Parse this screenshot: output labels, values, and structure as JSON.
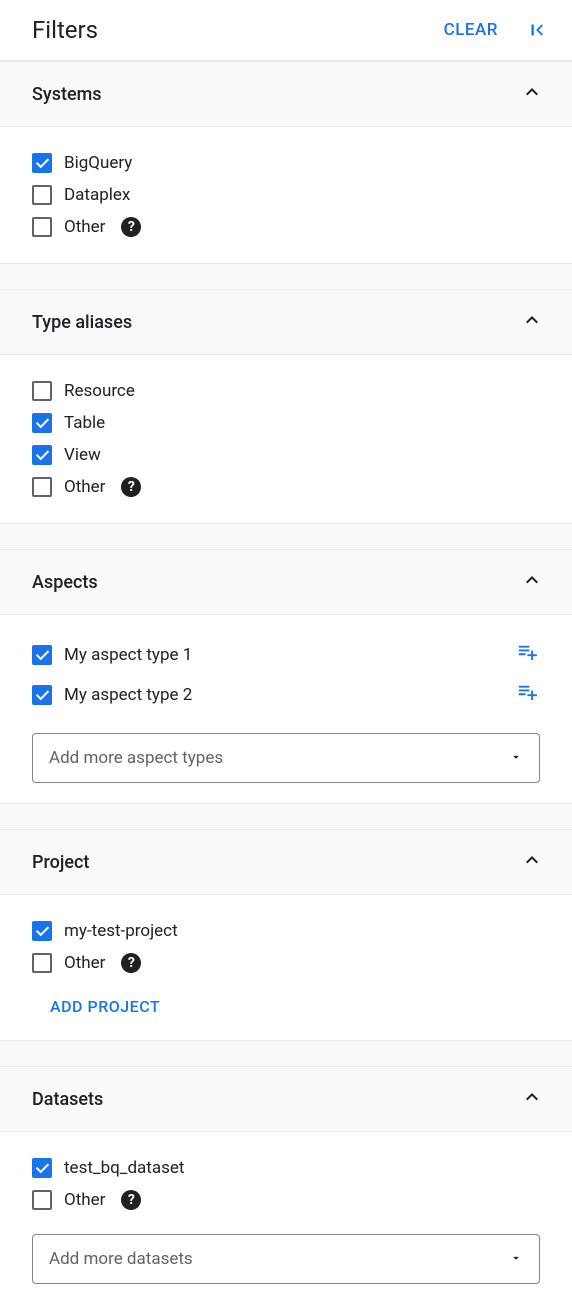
{
  "header": {
    "title": "Filters",
    "clear_label": "CLEAR"
  },
  "sections": {
    "systems": {
      "title": "Systems",
      "items": [
        {
          "label": "BigQuery",
          "checked": true,
          "help": false
        },
        {
          "label": "Dataplex",
          "checked": false,
          "help": false
        },
        {
          "label": "Other",
          "checked": false,
          "help": true
        }
      ]
    },
    "type_aliases": {
      "title": "Type aliases",
      "items": [
        {
          "label": "Resource",
          "checked": false,
          "help": false
        },
        {
          "label": "Table",
          "checked": true,
          "help": false
        },
        {
          "label": "View",
          "checked": true,
          "help": false
        },
        {
          "label": "Other",
          "checked": false,
          "help": true
        }
      ]
    },
    "aspects": {
      "title": "Aspects",
      "items": [
        {
          "label": "My aspect type 1",
          "checked": true,
          "add_action": true
        },
        {
          "label": "My aspect type 2",
          "checked": true,
          "add_action": true
        }
      ],
      "dropdown_placeholder": "Add more aspect types"
    },
    "project": {
      "title": "Project",
      "items": [
        {
          "label": "my-test-project",
          "checked": true,
          "help": false
        },
        {
          "label": "Other",
          "checked": false,
          "help": true
        }
      ],
      "add_button_label": "ADD PROJECT"
    },
    "datasets": {
      "title": "Datasets",
      "items": [
        {
          "label": "test_bq_dataset",
          "checked": true,
          "help": false
        },
        {
          "label": "Other",
          "checked": false,
          "help": true
        }
      ],
      "dropdown_placeholder": "Add more datasets"
    }
  }
}
